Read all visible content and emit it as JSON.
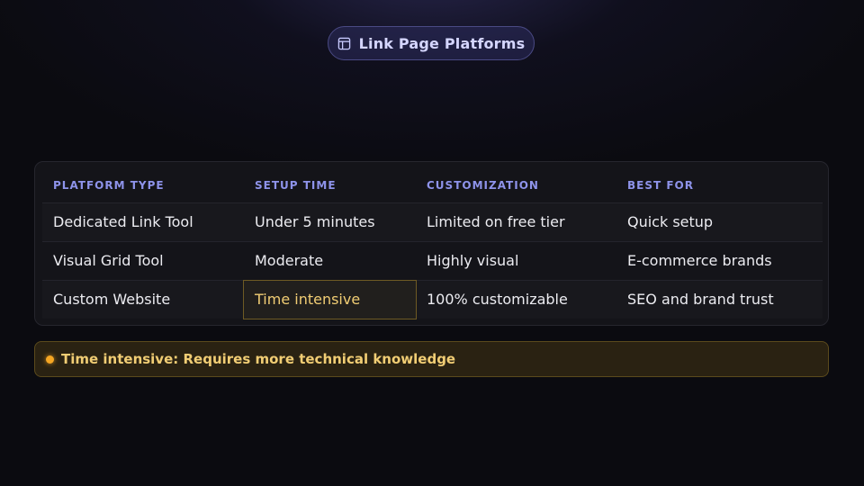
{
  "header": {
    "title": "Link Page Platforms",
    "icon": "table-icon"
  },
  "table": {
    "columns": [
      "PLATFORM TYPE",
      "SETUP TIME",
      "CUSTOMIZATION",
      "BEST FOR"
    ],
    "rows": [
      [
        "Dedicated Link Tool",
        "Under 5 minutes",
        "Limited on free tier",
        "Quick setup"
      ],
      [
        "Visual Grid Tool",
        "Moderate",
        "Highly visual",
        "E-commerce brands"
      ],
      [
        "Custom Website",
        "Time intensive",
        "100% customizable",
        "SEO and brand trust"
      ]
    ],
    "highlighted_cell": {
      "row": 2,
      "column": 1
    }
  },
  "note": {
    "text": "Time intensive: Requires more technical knowledge",
    "icon": "status-dot-icon"
  },
  "colors": {
    "accent": "#8e93ea",
    "highlight": "#f1cd74",
    "dot": "#f5a623",
    "background": "#0b0b10"
  }
}
